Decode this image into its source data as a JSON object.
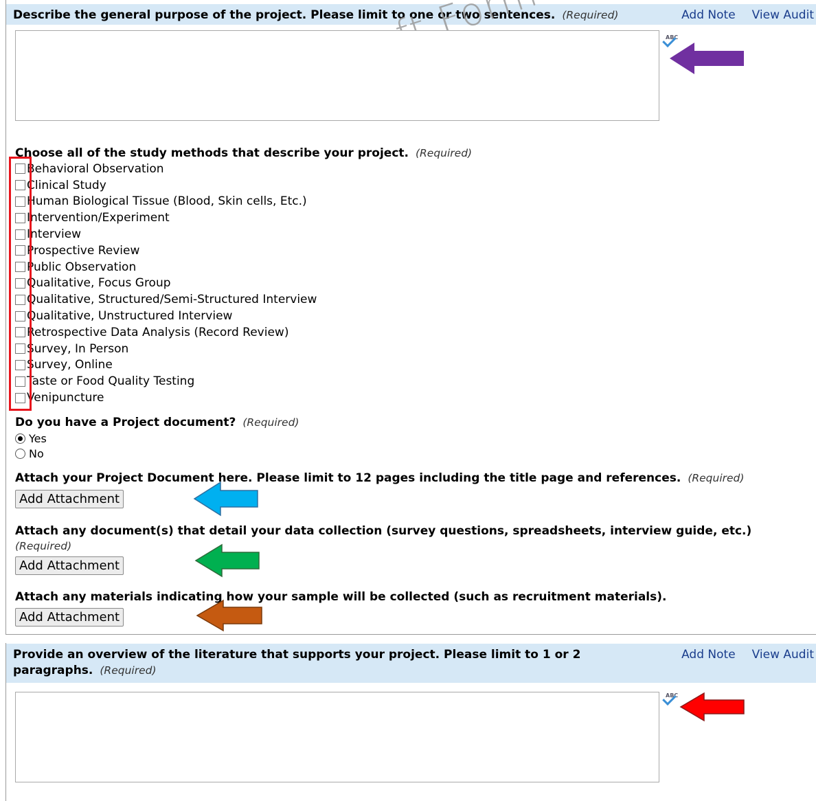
{
  "watermark": "Draft Form",
  "header_links": {
    "add_note": "Add Note",
    "view_audit": "View Audit"
  },
  "required_text": "(Required)",
  "spellcheck_label": "ABC",
  "question1": {
    "title": "Describe the general purpose of the project. Please limit to one or two sentences."
  },
  "methods": {
    "title": "Choose all of the study methods that describe your project.",
    "items": [
      "Behavioral Observation",
      "Clinical Study",
      "Human Biological Tissue (Blood, Skin cells, Etc.)",
      "Intervention/Experiment",
      "Interview",
      "Prospective Review",
      "Public Observation",
      "Qualitative, Focus Group",
      "Qualitative, Structured/Semi-Structured Interview",
      "Qualitative, Unstructured Interview",
      "Retrospective Data Analysis (Record Review)",
      "Survey, In Person",
      "Survey, Online",
      "Taste or Food Quality Testing",
      "Venipuncture"
    ]
  },
  "project_document": {
    "title": "Do you have a Project document?",
    "options": [
      "Yes",
      "No"
    ],
    "selected": "Yes"
  },
  "attach1": {
    "title": "Attach your Project Document here. Please limit to 12 pages including the title page and references.",
    "button": "Add Attachment"
  },
  "attach2": {
    "title": "Attach any document(s) that detail your data collection (survey questions, spreadsheets, interview guide, etc.)",
    "button": "Add Attachment"
  },
  "attach3": {
    "title": "Attach any materials indicating how your sample will be collected (such as recruitment materials).",
    "button": "Add Attachment"
  },
  "question2": {
    "title": "Provide an overview of the literature that supports your project. Please limit to 1 or 2 paragraphs."
  },
  "annotation_colors": {
    "purple": "#7030a0",
    "blue": "#00b0f0",
    "green": "#00b050",
    "orange": "#c55a11",
    "red": "#ff0000",
    "box": "#e8141c"
  }
}
